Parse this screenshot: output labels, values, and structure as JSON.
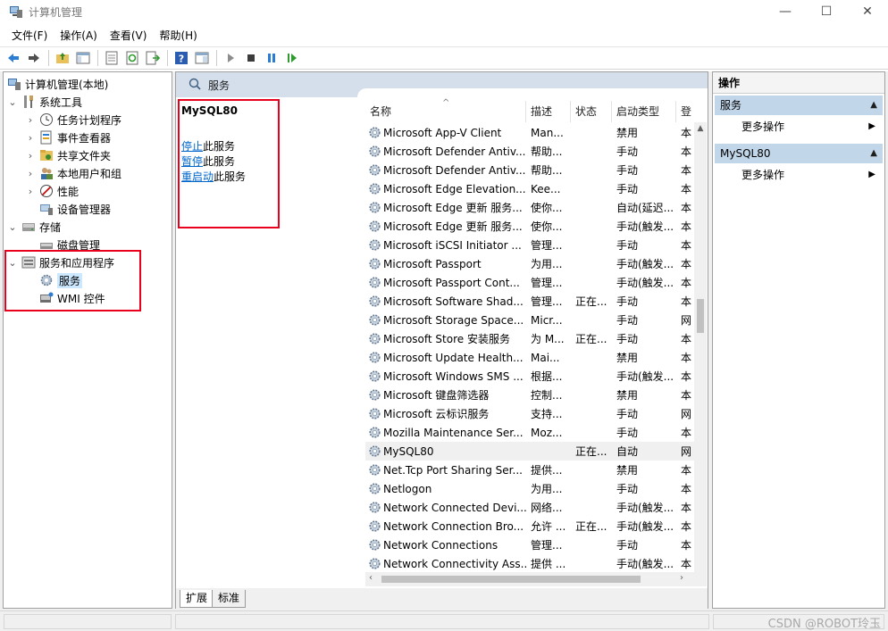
{
  "window": {
    "title": "计算机管理",
    "controls": {
      "minimize": "—",
      "maximize": "☐",
      "close": "✕"
    }
  },
  "menu": [
    "文件(F)",
    "操作(A)",
    "查看(V)",
    "帮助(H)"
  ],
  "toolbar": [
    "back-arrow-icon",
    "forward-arrow-icon",
    "folder-up-icon",
    "show-hide-tree-icon",
    "properties-icon",
    "refresh-icon",
    "export-list-icon",
    "help-icon",
    "view-icon",
    "play-icon",
    "stop-icon",
    "pause-icon",
    "resume-icon"
  ],
  "tree": {
    "root": "计算机管理(本地)",
    "items": [
      {
        "label": "系统工具"
      },
      {
        "label": "任务计划程序"
      },
      {
        "label": "事件查看器"
      },
      {
        "label": "共享文件夹"
      },
      {
        "label": "本地用户和组"
      },
      {
        "label": "性能"
      },
      {
        "label": "设备管理器"
      },
      {
        "label": "存储"
      },
      {
        "label": "磁盘管理"
      },
      {
        "label": "服务和应用程序"
      },
      {
        "label": "服务"
      },
      {
        "label": "WMI 控件"
      }
    ]
  },
  "center": {
    "header": "服务",
    "selected_service": "MySQL80",
    "actions": [
      {
        "link": "停止",
        "suffix": "此服务"
      },
      {
        "link": "暂停",
        "suffix": "此服务"
      },
      {
        "link": "重启动",
        "suffix": "此服务"
      }
    ],
    "columns": [
      "名称",
      "描述",
      "状态",
      "启动类型",
      "登"
    ],
    "rows": [
      {
        "name": "Microsoft App-V Client",
        "desc": "Man...",
        "status": "",
        "start": "禁用",
        "logon": "本"
      },
      {
        "name": "Microsoft Defender Antiv...",
        "desc": "帮助...",
        "status": "",
        "start": "手动",
        "logon": "本"
      },
      {
        "name": "Microsoft Defender Antiv...",
        "desc": "帮助...",
        "status": "",
        "start": "手动",
        "logon": "本"
      },
      {
        "name": "Microsoft Edge Elevation...",
        "desc": "Kee...",
        "status": "",
        "start": "手动",
        "logon": "本"
      },
      {
        "name": "Microsoft Edge 更新 服务...",
        "desc": "使你...",
        "status": "",
        "start": "自动(延迟...",
        "logon": "本"
      },
      {
        "name": "Microsoft Edge 更新 服务...",
        "desc": "使你...",
        "status": "",
        "start": "手动(触发...",
        "logon": "本"
      },
      {
        "name": "Microsoft iSCSI Initiator ...",
        "desc": "管理...",
        "status": "",
        "start": "手动",
        "logon": "本"
      },
      {
        "name": "Microsoft Passport",
        "desc": "为用...",
        "status": "",
        "start": "手动(触发...",
        "logon": "本"
      },
      {
        "name": "Microsoft Passport Cont...",
        "desc": "管理...",
        "status": "",
        "start": "手动(触发...",
        "logon": "本"
      },
      {
        "name": "Microsoft Software Shad...",
        "desc": "管理...",
        "status": "正在...",
        "start": "手动",
        "logon": "本"
      },
      {
        "name": "Microsoft Storage Space...",
        "desc": "Micr...",
        "status": "",
        "start": "手动",
        "logon": "网"
      },
      {
        "name": "Microsoft Store 安装服务",
        "desc": "为 M...",
        "status": "正在...",
        "start": "手动",
        "logon": "本"
      },
      {
        "name": "Microsoft Update Health...",
        "desc": "Mai...",
        "status": "",
        "start": "禁用",
        "logon": "本"
      },
      {
        "name": "Microsoft Windows SMS ...",
        "desc": "根据...",
        "status": "",
        "start": "手动(触发...",
        "logon": "本"
      },
      {
        "name": "Microsoft 键盘筛选器",
        "desc": "控制...",
        "status": "",
        "start": "禁用",
        "logon": "本"
      },
      {
        "name": "Microsoft 云标识服务",
        "desc": "支持...",
        "status": "",
        "start": "手动",
        "logon": "网"
      },
      {
        "name": "Mozilla Maintenance Ser...",
        "desc": "Moz...",
        "status": "",
        "start": "手动",
        "logon": "本"
      },
      {
        "name": "MySQL80",
        "desc": "",
        "status": "正在...",
        "start": "自动",
        "logon": "网"
      },
      {
        "name": "Net.Tcp Port Sharing Ser...",
        "desc": "提供...",
        "status": "",
        "start": "禁用",
        "logon": "本"
      },
      {
        "name": "Netlogon",
        "desc": "为用...",
        "status": "",
        "start": "手动",
        "logon": "本"
      },
      {
        "name": "Network Connected Devi...",
        "desc": "网络...",
        "status": "",
        "start": "手动(触发...",
        "logon": "本"
      },
      {
        "name": "Network Connection Bro...",
        "desc": "允许 ...",
        "status": "正在...",
        "start": "手动(触发...",
        "logon": "本"
      },
      {
        "name": "Network Connections",
        "desc": "管理...",
        "status": "",
        "start": "手动",
        "logon": "本"
      },
      {
        "name": "Network Connectivity Ass...",
        "desc": "提供 ...",
        "status": "",
        "start": "手动(触发...",
        "logon": "本"
      }
    ],
    "tabs": [
      "扩展",
      "标准"
    ]
  },
  "actions_pane": {
    "title": "操作",
    "groups": [
      {
        "label": "服务",
        "item": "更多操作"
      },
      {
        "label": "MySQL80",
        "item": "更多操作"
      }
    ]
  },
  "watermark": "CSDN @ROBOT玲玉"
}
